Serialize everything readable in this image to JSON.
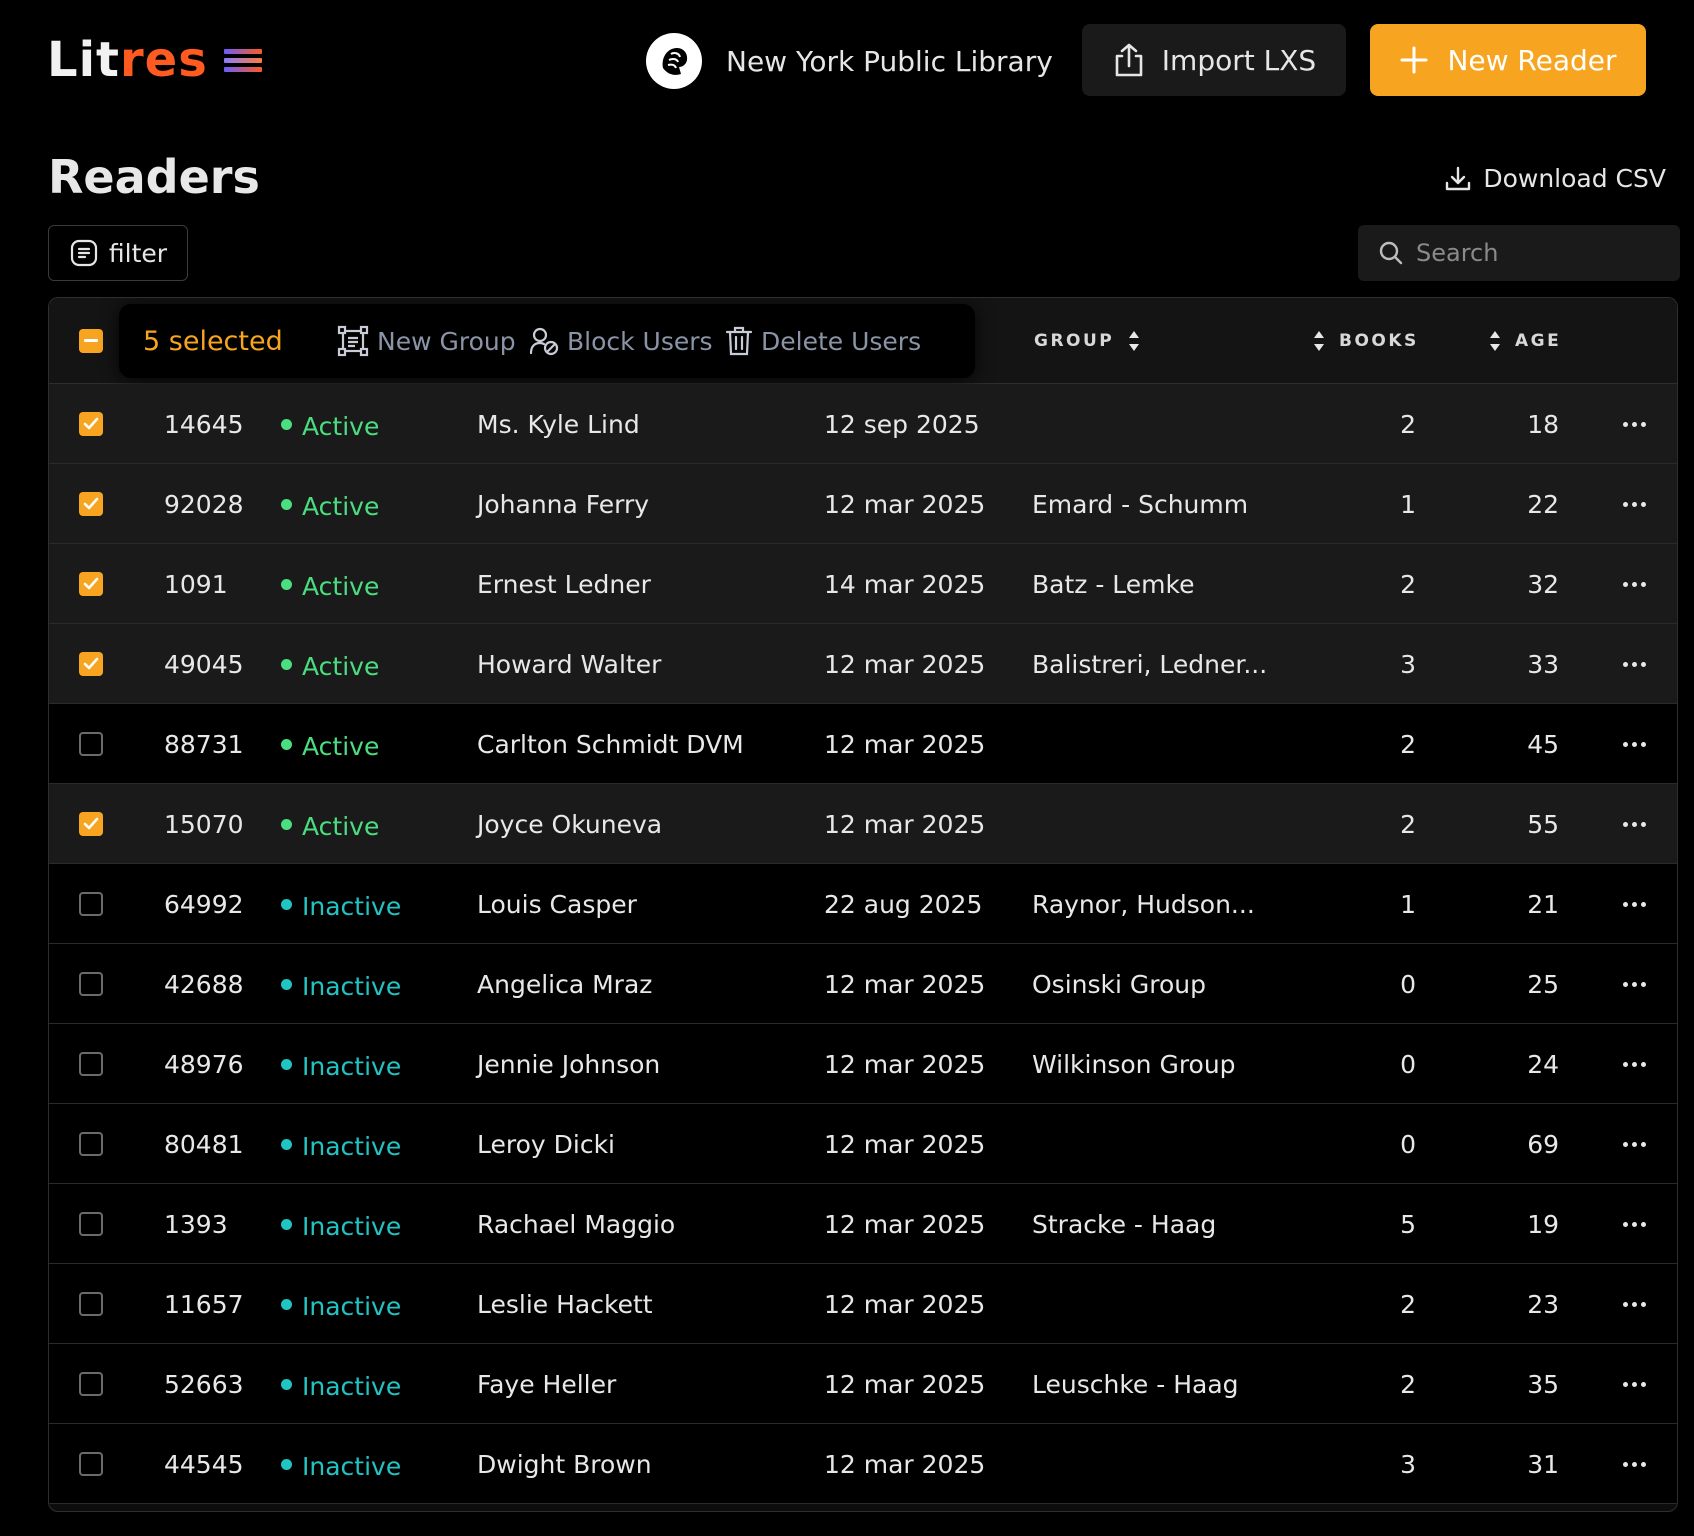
{
  "header": {
    "logo_lit": "Lit",
    "logo_res": "res",
    "library_name": "New York Public Library",
    "import_label": "Import LXS",
    "new_reader_label": "New Reader"
  },
  "page": {
    "title": "Readers",
    "download_label": "Download CSV",
    "filter_label": "filter",
    "search_placeholder": "Search"
  },
  "bulk": {
    "selected_label": "5 selected",
    "new_group": "New Group",
    "block_users": "Block Users",
    "delete_users": "Delete Users"
  },
  "columns": {
    "group": "GROUP",
    "books": "BOOKS",
    "age": "AGE"
  },
  "colors": {
    "accent": "#f7a521",
    "brand_res": "#ff5a1f",
    "active": "#4ade80",
    "inactive": "#22c3c3"
  },
  "rows": [
    {
      "selected": true,
      "id": "14645",
      "status": "Active",
      "name": "Ms. Kyle Lind",
      "date": "12 sep 2025",
      "group": "",
      "books": "2",
      "age": "18"
    },
    {
      "selected": true,
      "id": "92028",
      "status": "Active",
      "name": "Johanna Ferry",
      "date": "12 mar 2025",
      "group": "Emard - Schumm",
      "books": "1",
      "age": "22"
    },
    {
      "selected": true,
      "id": "1091",
      "status": "Active",
      "name": "Ernest Ledner",
      "date": "14 mar 2025",
      "group": "Batz - Lemke",
      "books": "2",
      "age": "32"
    },
    {
      "selected": true,
      "id": "49045",
      "status": "Active",
      "name": "Howard Walter",
      "date": "12 mar 2025",
      "group": "Balistreri, Ledner...",
      "books": "3",
      "age": "33"
    },
    {
      "selected": false,
      "id": "88731",
      "status": "Active",
      "name": "Carlton Schmidt DVM",
      "date": "12 mar 2025",
      "group": "",
      "books": "2",
      "age": "45"
    },
    {
      "selected": true,
      "id": "15070",
      "status": "Active",
      "name": "Joyce Okuneva",
      "date": "12 mar 2025",
      "group": "",
      "books": "2",
      "age": "55"
    },
    {
      "selected": false,
      "id": "64992",
      "status": "Inactive",
      "name": "Louis Casper",
      "date": "22 aug 2025",
      "group": "Raynor, Hudson...",
      "books": "1",
      "age": "21"
    },
    {
      "selected": false,
      "id": "42688",
      "status": "Inactive",
      "name": "Angelica Mraz",
      "date": "12 mar 2025",
      "group": "Osinski Group",
      "books": "0",
      "age": "25"
    },
    {
      "selected": false,
      "id": "48976",
      "status": "Inactive",
      "name": "Jennie Johnson",
      "date": "12 mar 2025",
      "group": "Wilkinson Group",
      "books": "0",
      "age": "24"
    },
    {
      "selected": false,
      "id": "80481",
      "status": "Inactive",
      "name": "Leroy Dicki",
      "date": "12 mar 2025",
      "group": "",
      "books": "0",
      "age": "69"
    },
    {
      "selected": false,
      "id": "1393",
      "status": "Inactive",
      "name": "Rachael Maggio",
      "date": "12 mar 2025",
      "group": "Stracke - Haag",
      "books": "5",
      "age": "19"
    },
    {
      "selected": false,
      "id": "11657",
      "status": "Inactive",
      "name": "Leslie Hackett",
      "date": "12 mar 2025",
      "group": "",
      "books": "2",
      "age": "23"
    },
    {
      "selected": false,
      "id": "52663",
      "status": "Inactive",
      "name": "Faye Heller",
      "date": "12 mar 2025",
      "group": "Leuschke - Haag",
      "books": "2",
      "age": "35"
    },
    {
      "selected": false,
      "id": "44545",
      "status": "Inactive",
      "name": "Dwight Brown",
      "date": "12 mar 2025",
      "group": "",
      "books": "3",
      "age": "31"
    }
  ]
}
